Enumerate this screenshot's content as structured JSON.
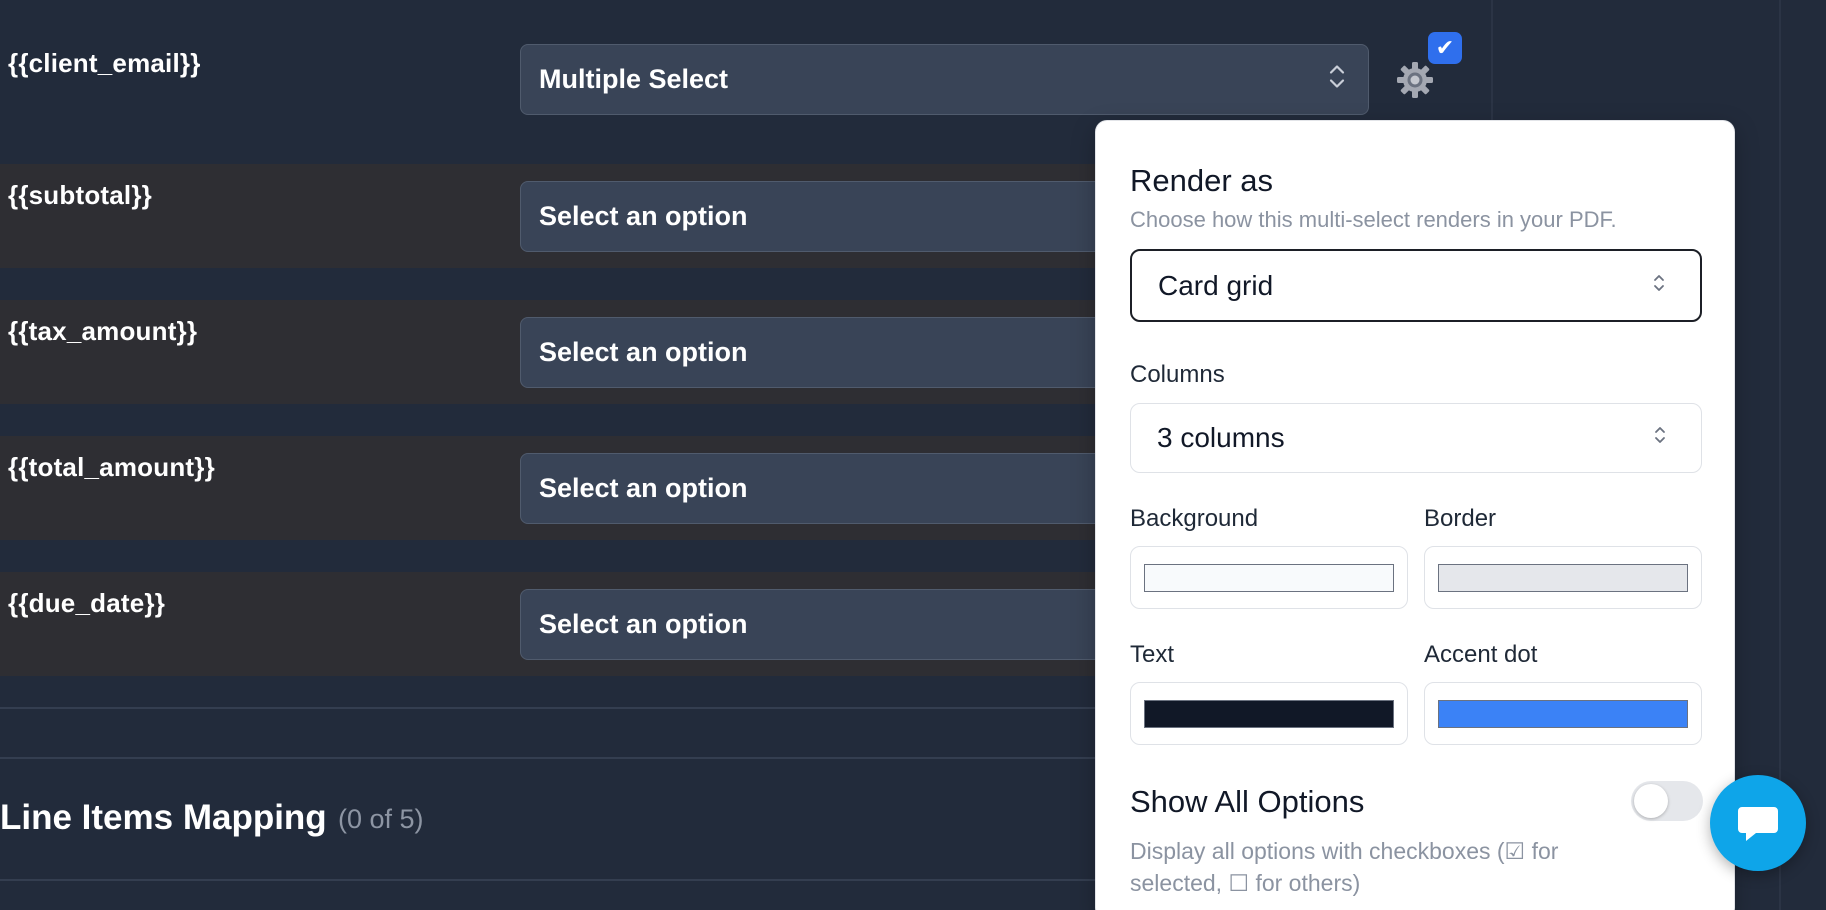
{
  "rows": [
    {
      "label": "{{client_email}}",
      "value": "Multiple Select"
    },
    {
      "label": "{{subtotal}}",
      "value": "Select an option"
    },
    {
      "label": "{{tax_amount}}",
      "value": "Select an option"
    },
    {
      "label": "{{total_amount}}",
      "value": "Select an option"
    },
    {
      "label": "{{due_date}}",
      "value": "Select an option"
    }
  ],
  "row_settings": {
    "checkmark": "✔"
  },
  "section": {
    "title": "Line Items Mapping",
    "count": "(0 of 5)"
  },
  "popover": {
    "title": "Render as",
    "subtitle": "Choose how this multi-select renders in your PDF.",
    "render_value": "Card grid",
    "columns_label": "Columns",
    "columns_value": "3 columns",
    "background_label": "Background",
    "border_label": "Border",
    "text_label": "Text",
    "accent_label": "Accent dot",
    "colors": {
      "background": "#f8fafc",
      "border": "#e5e7eb",
      "text": "#111827",
      "accent": "#3b82f6"
    },
    "show_all_title": "Show All Options",
    "show_all_enabled": false,
    "show_all_desc": "Display all options with checkboxes (☑ for selected, ☐ for others)"
  },
  "icons": [
    "gear-icon",
    "check-badge-icon",
    "chevron-updown-icon",
    "chat-bubble-icon"
  ]
}
